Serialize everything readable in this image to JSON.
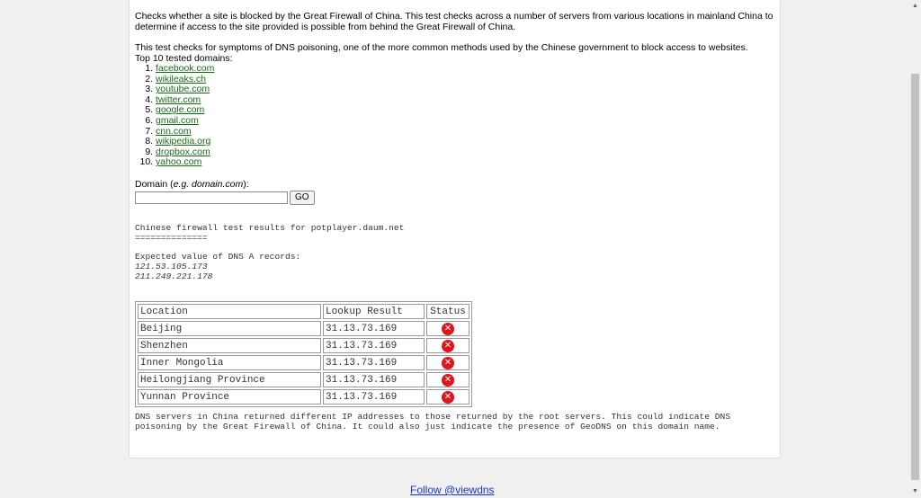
{
  "intro": {
    "paragraph1": "Checks whether a site is blocked by the Great Firewall of China. This test checks across a number of servers from various locations in mainland China to determine if access to the site provided is possible from behind the Great Firewall of China.",
    "paragraph2": "This test checks for symptoms of DNS poisoning, one of the more common methods used by the Chinese government to block access to websites.",
    "top_domains_label": "Top 10 tested domains:"
  },
  "top_domains": [
    "facebook.com",
    "wikileaks.ch",
    "youtube.com",
    "twitter.com",
    "google.com",
    "gmail.com",
    "cnn.com",
    "wikipedia.org",
    "dropbox.com",
    "yahoo.com"
  ],
  "form": {
    "label_prefix": "Domain (",
    "label_example_prefix": "e.g. ",
    "label_example_domain": "domain.com",
    "label_suffix": "):",
    "input_value": "",
    "go_label": "GO"
  },
  "results": {
    "heading": "Chinese firewall test results for potplayer.daum.net",
    "underline": "==============",
    "expected_label": "Expected value of DNS A records:",
    "expected_ips": [
      "121.53.105.173",
      "211.249.221.178"
    ],
    "columns": [
      "Location",
      "Lookup Result",
      "Status"
    ],
    "rows": [
      {
        "location": "Beijing",
        "result": "31.13.73.169",
        "status": "fail"
      },
      {
        "location": "Shenzhen",
        "result": "31.13.73.169",
        "status": "fail"
      },
      {
        "location": "Inner Mongolia",
        "result": "31.13.73.169",
        "status": "fail"
      },
      {
        "location": "Heilongjiang Province",
        "result": "31.13.73.169",
        "status": "fail"
      },
      {
        "location": "Yunnan Province",
        "result": "31.13.73.169",
        "status": "fail"
      }
    ],
    "status_icon": "error-x-icon",
    "status_color": "#e0141a",
    "note": "DNS servers in China returned different IP addresses to those returned by the root servers. This could indicate DNS poisoning by the Great Firewall of China. It could also just indicate the presence of GeoDNS on this domain name."
  },
  "footer": {
    "link_text": "Follow @viewdns"
  },
  "colors": {
    "link": "#176b17",
    "footer_link": "#1a35c9",
    "background": "#f0f0f0"
  }
}
